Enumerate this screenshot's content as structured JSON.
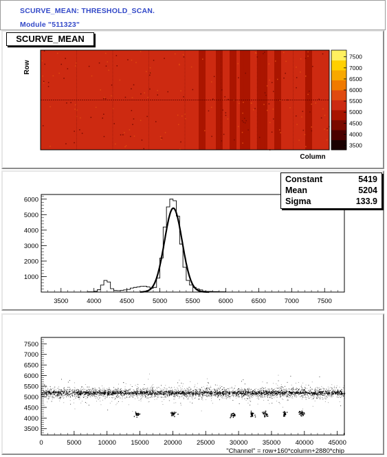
{
  "header": {
    "line1": "SCURVE_MEAN: THRESHOLD_SCAN.",
    "line2": "Module \"511323\""
  },
  "colors": {
    "header_text": "#3349c8",
    "map_fill": "#cc2a12",
    "palette": [
      "#1a0000",
      "#4a0000",
      "#7a0a00",
      "#a81400",
      "#cc2a12",
      "#e04a10",
      "#f07a00",
      "#f8a800",
      "#ffd000",
      "#fff060"
    ]
  },
  "chart_data": [
    {
      "type": "heatmap",
      "title": "SCURVE_MEAN",
      "xlabel": "Column",
      "ylabel": "Row",
      "colorbar_ticks": [
        3500,
        4000,
        4500,
        5000,
        5500,
        6000,
        6500,
        7000,
        7500
      ],
      "zlim": [
        3300,
        7800
      ],
      "dominant_value": 5200,
      "darker_stripes": "several vertical columns near x ≈ 0.55–0.77 of width"
    },
    {
      "type": "line",
      "series": [
        {
          "name": "histogram",
          "style": "step",
          "x": [
            3300,
            3500,
            3700,
            3900,
            4000,
            4050,
            4100,
            4150,
            4200,
            4250,
            4300,
            4350,
            4400,
            4450,
            4500,
            4550,
            4600,
            4650,
            4700,
            4750,
            4800,
            4850,
            4900,
            4950,
            5000,
            5050,
            5100,
            5150,
            5200,
            5250,
            5300,
            5350,
            5400,
            5450,
            5500,
            5550,
            5600,
            5650,
            5700,
            5800,
            5900,
            6000,
            6100,
            6300,
            6600,
            7000,
            7500
          ],
          "values": [
            0,
            0,
            0,
            20,
            50,
            150,
            450,
            750,
            650,
            220,
            100,
            90,
            110,
            140,
            170,
            260,
            300,
            330,
            370,
            380,
            330,
            250,
            300,
            900,
            2200,
            4200,
            5500,
            6000,
            5900,
            4900,
            3100,
            1600,
            750,
            450,
            300,
            200,
            140,
            60,
            40,
            30,
            20,
            0,
            0,
            0,
            0,
            0,
            0
          ]
        },
        {
          "name": "gaussian fit",
          "style": "smooth",
          "constant": 5419,
          "mean": 5204,
          "sigma": 133.9
        }
      ],
      "x_ticks": [
        3500,
        4000,
        4500,
        5000,
        5500,
        6000,
        6500,
        7000,
        7500
      ],
      "y_ticks": [
        1000,
        2000,
        3000,
        4000,
        5000,
        6000
      ],
      "xlim": [
        3200,
        7800
      ],
      "ylim": [
        0,
        6300
      ],
      "stats": [
        {
          "label": "Constant",
          "value": "5419"
        },
        {
          "label": "Mean",
          "value": "5204"
        },
        {
          "label": "Sigma",
          "value": "133.9"
        }
      ]
    },
    {
      "type": "scatter",
      "xlabel": "\"Channel\" = row+160*column+2880*chip",
      "x_ticks": [
        0,
        5000,
        10000,
        15000,
        20000,
        25000,
        30000,
        35000,
        40000,
        45000
      ],
      "y_ticks": [
        3500,
        4000,
        4500,
        5000,
        5500,
        6000,
        6500,
        7000,
        7500
      ],
      "xlim": [
        0,
        46080
      ],
      "ylim": [
        3200,
        7800
      ],
      "band": {
        "center": 5200,
        "spread": 120
      },
      "low_clusters": [
        {
          "x": 14500,
          "y": 4200
        },
        {
          "x": 20000,
          "y": 4200
        },
        {
          "x": 29000,
          "y": 4150
        },
        {
          "x": 32000,
          "y": 4200
        },
        {
          "x": 34000,
          "y": 4200
        },
        {
          "x": 37000,
          "y": 4200
        },
        {
          "x": 39500,
          "y": 4250
        }
      ]
    }
  ]
}
